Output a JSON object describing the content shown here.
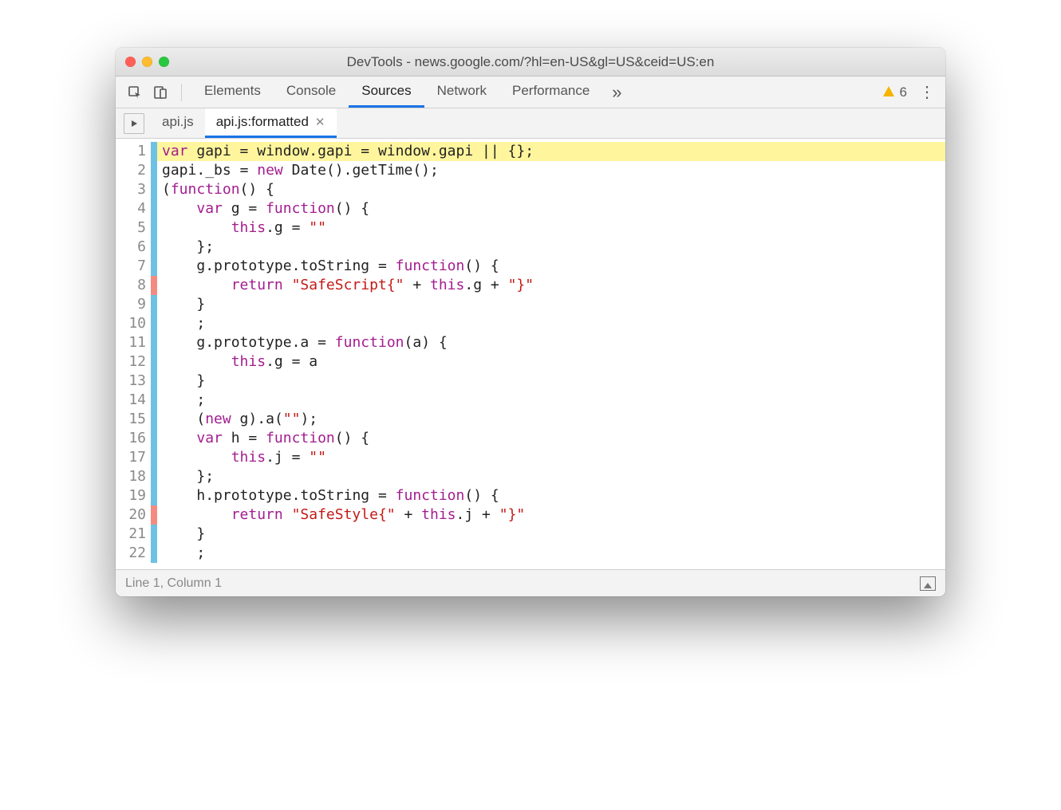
{
  "title": "DevTools - news.google.com/?hl=en-US&gl=US&ceid=US:en",
  "panels": {
    "items": [
      "Elements",
      "Console",
      "Sources",
      "Network",
      "Performance"
    ],
    "activeIndex": 2
  },
  "warnings": {
    "count": "6"
  },
  "fileTabs": {
    "items": [
      {
        "label": "api.js",
        "active": false
      },
      {
        "label": "api.js:formatted",
        "active": true
      }
    ]
  },
  "code": {
    "lines": [
      {
        "n": "1",
        "marker": "blue",
        "highlight": true,
        "tokens": [
          [
            "kw",
            "var"
          ],
          [
            "id",
            " gapi "
          ],
          [
            "op",
            "="
          ],
          [
            "id",
            " window"
          ],
          [
            "op",
            "."
          ],
          [
            "id",
            "gapi "
          ],
          [
            "op",
            "="
          ],
          [
            "id",
            " window"
          ],
          [
            "op",
            "."
          ],
          [
            "id",
            "gapi "
          ],
          [
            "op",
            "||"
          ],
          [
            "id",
            " {}"
          ],
          [
            "op",
            ";"
          ]
        ]
      },
      {
        "n": "2",
        "marker": "blue",
        "tokens": [
          [
            "id",
            "gapi"
          ],
          [
            "op",
            "."
          ],
          [
            "id",
            "_bs "
          ],
          [
            "op",
            "="
          ],
          [
            "id",
            " "
          ],
          [
            "kw",
            "new"
          ],
          [
            "id",
            " Date"
          ],
          [
            "op",
            "()."
          ],
          [
            "id",
            "getTime"
          ],
          [
            "op",
            "();"
          ]
        ]
      },
      {
        "n": "3",
        "marker": "blue",
        "tokens": [
          [
            "op",
            "("
          ],
          [
            "kw",
            "function"
          ],
          [
            "op",
            "() {"
          ]
        ]
      },
      {
        "n": "4",
        "marker": "blue",
        "tokens": [
          [
            "id",
            "    "
          ],
          [
            "kw",
            "var"
          ],
          [
            "id",
            " g "
          ],
          [
            "op",
            "="
          ],
          [
            "id",
            " "
          ],
          [
            "kw",
            "function"
          ],
          [
            "op",
            "() {"
          ]
        ]
      },
      {
        "n": "5",
        "marker": "blue",
        "tokens": [
          [
            "id",
            "        "
          ],
          [
            "kw",
            "this"
          ],
          [
            "op",
            "."
          ],
          [
            "id",
            "g "
          ],
          [
            "op",
            "="
          ],
          [
            "id",
            " "
          ],
          [
            "str",
            "\"\""
          ]
        ]
      },
      {
        "n": "6",
        "marker": "blue",
        "tokens": [
          [
            "id",
            "    "
          ],
          [
            "op",
            "};"
          ]
        ]
      },
      {
        "n": "7",
        "marker": "blue",
        "tokens": [
          [
            "id",
            "    g"
          ],
          [
            "op",
            "."
          ],
          [
            "id",
            "prototype"
          ],
          [
            "op",
            "."
          ],
          [
            "id",
            "toString "
          ],
          [
            "op",
            "="
          ],
          [
            "id",
            " "
          ],
          [
            "kw",
            "function"
          ],
          [
            "op",
            "() {"
          ]
        ]
      },
      {
        "n": "8",
        "marker": "red",
        "tokens": [
          [
            "id",
            "        "
          ],
          [
            "kw",
            "return"
          ],
          [
            "id",
            " "
          ],
          [
            "str",
            "\"SafeScript{\""
          ],
          [
            "id",
            " "
          ],
          [
            "op",
            "+"
          ],
          [
            "id",
            " "
          ],
          [
            "kw",
            "this"
          ],
          [
            "op",
            "."
          ],
          [
            "id",
            "g "
          ],
          [
            "op",
            "+"
          ],
          [
            "id",
            " "
          ],
          [
            "str",
            "\"}\""
          ]
        ]
      },
      {
        "n": "9",
        "marker": "blue",
        "tokens": [
          [
            "id",
            "    "
          ],
          [
            "op",
            "}"
          ]
        ]
      },
      {
        "n": "10",
        "marker": "blue",
        "tokens": [
          [
            "id",
            "    "
          ],
          [
            "op",
            ";"
          ]
        ]
      },
      {
        "n": "11",
        "marker": "blue",
        "tokens": [
          [
            "id",
            "    g"
          ],
          [
            "op",
            "."
          ],
          [
            "id",
            "prototype"
          ],
          [
            "op",
            "."
          ],
          [
            "id",
            "a "
          ],
          [
            "op",
            "="
          ],
          [
            "id",
            " "
          ],
          [
            "kw",
            "function"
          ],
          [
            "op",
            "("
          ],
          [
            "id",
            "a"
          ],
          [
            "op",
            ") {"
          ]
        ]
      },
      {
        "n": "12",
        "marker": "blue",
        "tokens": [
          [
            "id",
            "        "
          ],
          [
            "kw",
            "this"
          ],
          [
            "op",
            "."
          ],
          [
            "id",
            "g "
          ],
          [
            "op",
            "="
          ],
          [
            "id",
            " a"
          ]
        ]
      },
      {
        "n": "13",
        "marker": "blue",
        "tokens": [
          [
            "id",
            "    "
          ],
          [
            "op",
            "}"
          ]
        ]
      },
      {
        "n": "14",
        "marker": "blue",
        "tokens": [
          [
            "id",
            "    "
          ],
          [
            "op",
            ";"
          ]
        ]
      },
      {
        "n": "15",
        "marker": "blue",
        "tokens": [
          [
            "id",
            "    "
          ],
          [
            "op",
            "("
          ],
          [
            "kw",
            "new"
          ],
          [
            "id",
            " g"
          ],
          [
            "op",
            ")."
          ],
          [
            "id",
            "a"
          ],
          [
            "op",
            "("
          ],
          [
            "str",
            "\"\""
          ],
          [
            "op",
            ");"
          ]
        ]
      },
      {
        "n": "16",
        "marker": "blue",
        "tokens": [
          [
            "id",
            "    "
          ],
          [
            "kw",
            "var"
          ],
          [
            "id",
            " h "
          ],
          [
            "op",
            "="
          ],
          [
            "id",
            " "
          ],
          [
            "kw",
            "function"
          ],
          [
            "op",
            "() {"
          ]
        ]
      },
      {
        "n": "17",
        "marker": "blue",
        "tokens": [
          [
            "id",
            "        "
          ],
          [
            "kw",
            "this"
          ],
          [
            "op",
            "."
          ],
          [
            "id",
            "j "
          ],
          [
            "op",
            "="
          ],
          [
            "id",
            " "
          ],
          [
            "str",
            "\"\""
          ]
        ]
      },
      {
        "n": "18",
        "marker": "blue",
        "tokens": [
          [
            "id",
            "    "
          ],
          [
            "op",
            "};"
          ]
        ]
      },
      {
        "n": "19",
        "marker": "blue",
        "tokens": [
          [
            "id",
            "    h"
          ],
          [
            "op",
            "."
          ],
          [
            "id",
            "prototype"
          ],
          [
            "op",
            "."
          ],
          [
            "id",
            "toString "
          ],
          [
            "op",
            "="
          ],
          [
            "id",
            " "
          ],
          [
            "kw",
            "function"
          ],
          [
            "op",
            "() {"
          ]
        ]
      },
      {
        "n": "20",
        "marker": "red",
        "tokens": [
          [
            "id",
            "        "
          ],
          [
            "kw",
            "return"
          ],
          [
            "id",
            " "
          ],
          [
            "str",
            "\"SafeStyle{\""
          ],
          [
            "id",
            " "
          ],
          [
            "op",
            "+"
          ],
          [
            "id",
            " "
          ],
          [
            "kw",
            "this"
          ],
          [
            "op",
            "."
          ],
          [
            "id",
            "j "
          ],
          [
            "op",
            "+"
          ],
          [
            "id",
            " "
          ],
          [
            "str",
            "\"}\""
          ]
        ]
      },
      {
        "n": "21",
        "marker": "blue",
        "tokens": [
          [
            "id",
            "    "
          ],
          [
            "op",
            "}"
          ]
        ]
      },
      {
        "n": "22",
        "marker": "blue",
        "tokens": [
          [
            "id",
            "    "
          ],
          [
            "op",
            ";"
          ]
        ]
      }
    ]
  },
  "status": {
    "position": "Line 1, Column 1"
  }
}
